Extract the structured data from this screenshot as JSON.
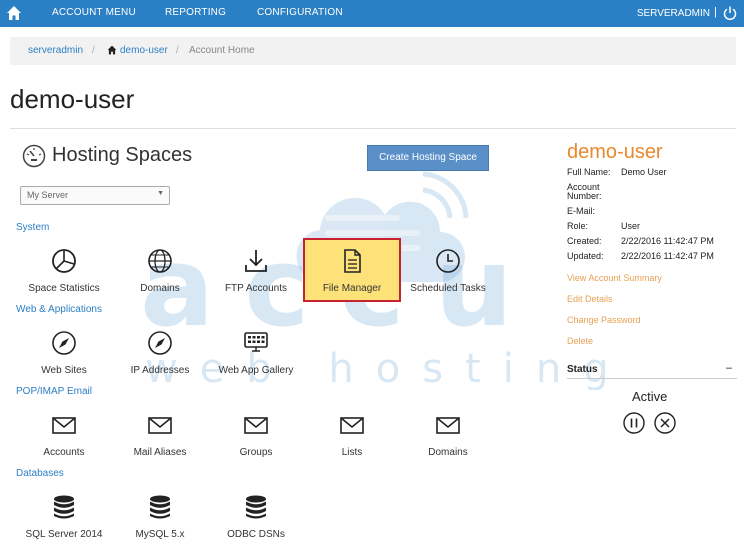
{
  "topbar": {
    "nav": [
      "ACCOUNT MENU",
      "REPORTING",
      "CONFIGURATION"
    ],
    "user": "SERVERADMIN",
    "separator": "|"
  },
  "breadcrumb": {
    "root": "serveradmin",
    "user": "demo-user",
    "current": "Account Home"
  },
  "page_title": "demo-user",
  "hosting": {
    "title": "Hosting Spaces",
    "create_button": "Create Hosting Space",
    "server_select": "My Server"
  },
  "sections": {
    "system": {
      "label": "System",
      "items": [
        "Space Statistics",
        "Domains",
        "FTP Accounts",
        "File Manager",
        "Scheduled Tasks"
      ]
    },
    "web": {
      "label": "Web & Applications",
      "items": [
        "Web Sites",
        "IP Addresses",
        "Web App Gallery"
      ]
    },
    "mail": {
      "label": "POP/IMAP Email",
      "items": [
        "Accounts",
        "Mail Aliases",
        "Groups",
        "Lists",
        "Domains"
      ]
    },
    "db": {
      "label": "Databases",
      "items": [
        "SQL Server 2014",
        "MySQL 5.x",
        "ODBC DSNs"
      ]
    }
  },
  "account": {
    "name": "demo-user",
    "full_name_label": "Full Name:",
    "full_name": "Demo User",
    "account_number_label_1": "Account",
    "account_number_label_2": "Number:",
    "email_label": "E-Mail:",
    "role_label": "Role:",
    "role": "User",
    "created_label": "Created:",
    "created": "2/22/2016 11:42:47 PM",
    "updated_label": "Updated:",
    "updated": "2/22/2016 11:42:47 PM",
    "links": [
      "View Account Summary",
      "Edit Details",
      "Change Password",
      "Delete"
    ]
  },
  "status": {
    "title": "Status",
    "collapse": "–",
    "state": "Active"
  },
  "watermark": {
    "brand": "accu",
    "tagline": "web hosting"
  },
  "colors": {
    "topbar": "#2b7fc4",
    "link": "#2b7fc4",
    "accent_orange": "#e8892c",
    "highlight_fill": "#fde27a",
    "highlight_border": "#c8232c"
  }
}
